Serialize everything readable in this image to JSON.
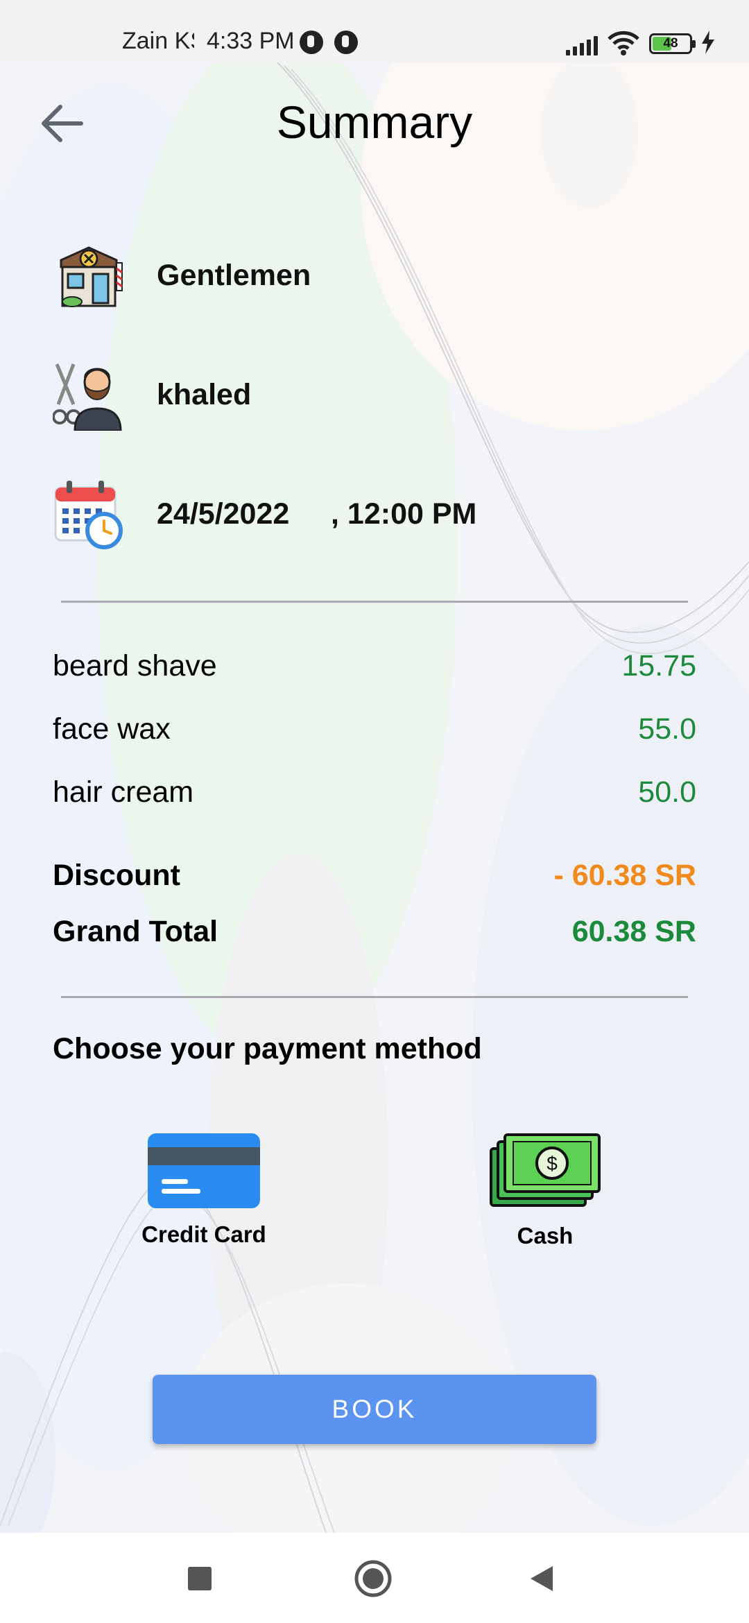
{
  "status_bar": {
    "carrier": "Zain KSA",
    "time": "4:33 PM",
    "battery_level": "48"
  },
  "header": {
    "title": "Summary"
  },
  "booking": {
    "shop_name": "Gentlemen",
    "barber_name": "khaled",
    "date_time": "24/5/2022     , 12:00 PM"
  },
  "services": [
    {
      "name": "beard shave",
      "price": "15.75"
    },
    {
      "name": "face wax",
      "price": "55.0"
    },
    {
      "name": "hair cream",
      "price": "50.0"
    }
  ],
  "totals": {
    "discount_label": "Discount",
    "discount_value": "- 60.38 SR",
    "grand_total_label": "Grand Total",
    "grand_total_value": "60.38 SR"
  },
  "payment": {
    "heading": "Choose your payment method",
    "options": [
      {
        "label": "Credit Card"
      },
      {
        "label": "Cash"
      }
    ]
  },
  "actions": {
    "book_label": "BOOK"
  },
  "colors": {
    "price_green": "#1b8a3a",
    "discount_orange": "#f08a1c",
    "book_button": "#5b93f1"
  }
}
